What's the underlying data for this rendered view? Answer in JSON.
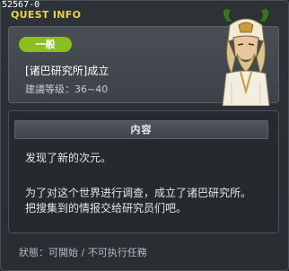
{
  "quest_id": "52567-0",
  "window_title": "QUEST INFO",
  "header": {
    "category": "一般",
    "quest_name": "[诸巴研究所]成立",
    "level_label": "建議等级：36~40"
  },
  "content": {
    "section_title": "内容",
    "lines": [
      "发现了新的次元。",
      "为了对这个世界进行调查，成立了诸巴研究所。",
      "把搜集到的情报交给研究员们吧。"
    ]
  },
  "status_text": "狀態：可開始 / 不可执行任務",
  "colors": {
    "title": "#e8d34a",
    "badge": "#8bbf1f",
    "background": "#2b2f34"
  },
  "npc_portrait": "elf-sage-npc-portrait"
}
